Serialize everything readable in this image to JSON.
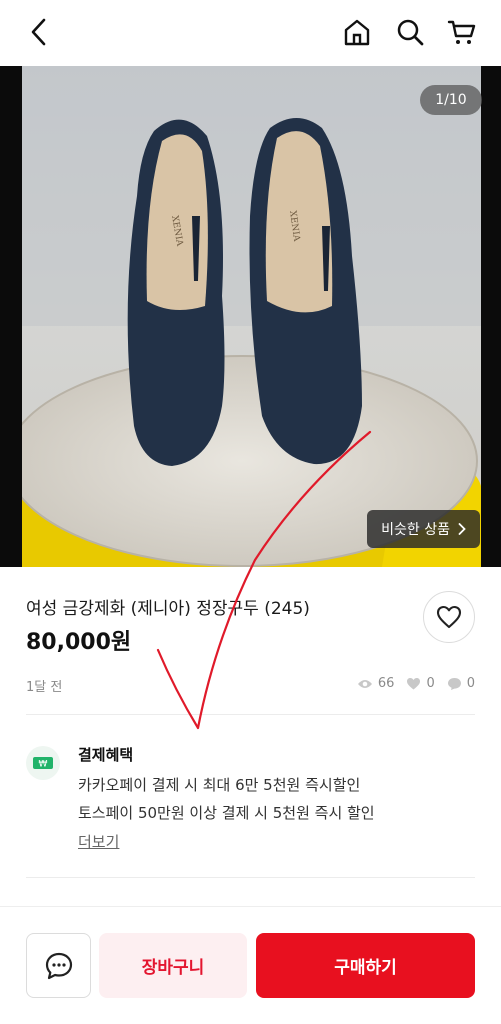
{
  "header": {
    "icons": [
      "back-arrow-icon",
      "home-icon",
      "search-icon",
      "cart-icon"
    ]
  },
  "gallery": {
    "counter": "1/10",
    "similar_label": "비슷한 상품",
    "brand_on_insole": "XENIA"
  },
  "product": {
    "title": "여성 금강제화 (제니아) 정장구두 (245)",
    "price": "80,000원",
    "posted": "1달 전",
    "views": "66",
    "likes": "0",
    "chats": "0"
  },
  "benefits": {
    "title": "결제혜택",
    "line1": "카카오페이 결제 시 최대 6만 5천원 즉시할인",
    "line2": "토스페이 50만원 이상 결제 시 5천원 즉시 할인",
    "more": "더보기",
    "icon_glyph": "₩"
  },
  "bottom_bar": {
    "basket_label": "장바구니",
    "buy_label": "구매하기"
  },
  "colors": {
    "accent_red": "#e8101f",
    "basket_bg": "#fdeff1",
    "annotation_red": "#e01a2a"
  }
}
